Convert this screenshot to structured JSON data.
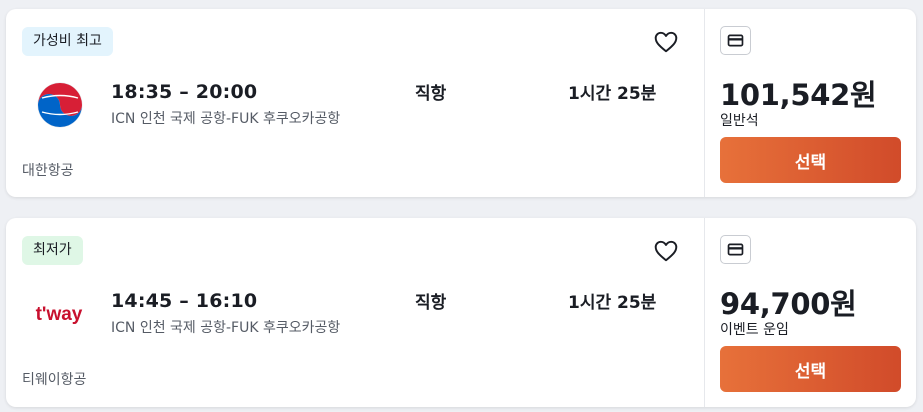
{
  "flights": [
    {
      "badge": "가성비 최고",
      "badge_color": "#e3f4fd",
      "times": "18:35 – 20:00",
      "route": "ICN 인천 국제 공항-FUK 후쿠오카공항",
      "stops": "직항",
      "duration": "1시간 25분",
      "airline": "대한항공",
      "airline_logo": "korean-air-logo",
      "price": "101,542원",
      "fare_type": "일반석",
      "select_label": "선택",
      "saved": false
    },
    {
      "badge": "최저가",
      "badge_color": "#dff7e6",
      "times": "14:45 – 16:10",
      "route": "ICN 인천 국제 공항-FUK 후쿠오카공항",
      "stops": "직항",
      "duration": "1시간 25분",
      "airline": "티웨이항공",
      "airline_logo": "tway-logo",
      "logo_text": "t'way",
      "price": "94,700원",
      "fare_type": "이벤트 운임",
      "select_label": "선택",
      "saved": false
    }
  ],
  "colors": {
    "accent_start": "#e7713a",
    "accent_end": "#d14b2a",
    "tway_red": "#c8102e"
  }
}
